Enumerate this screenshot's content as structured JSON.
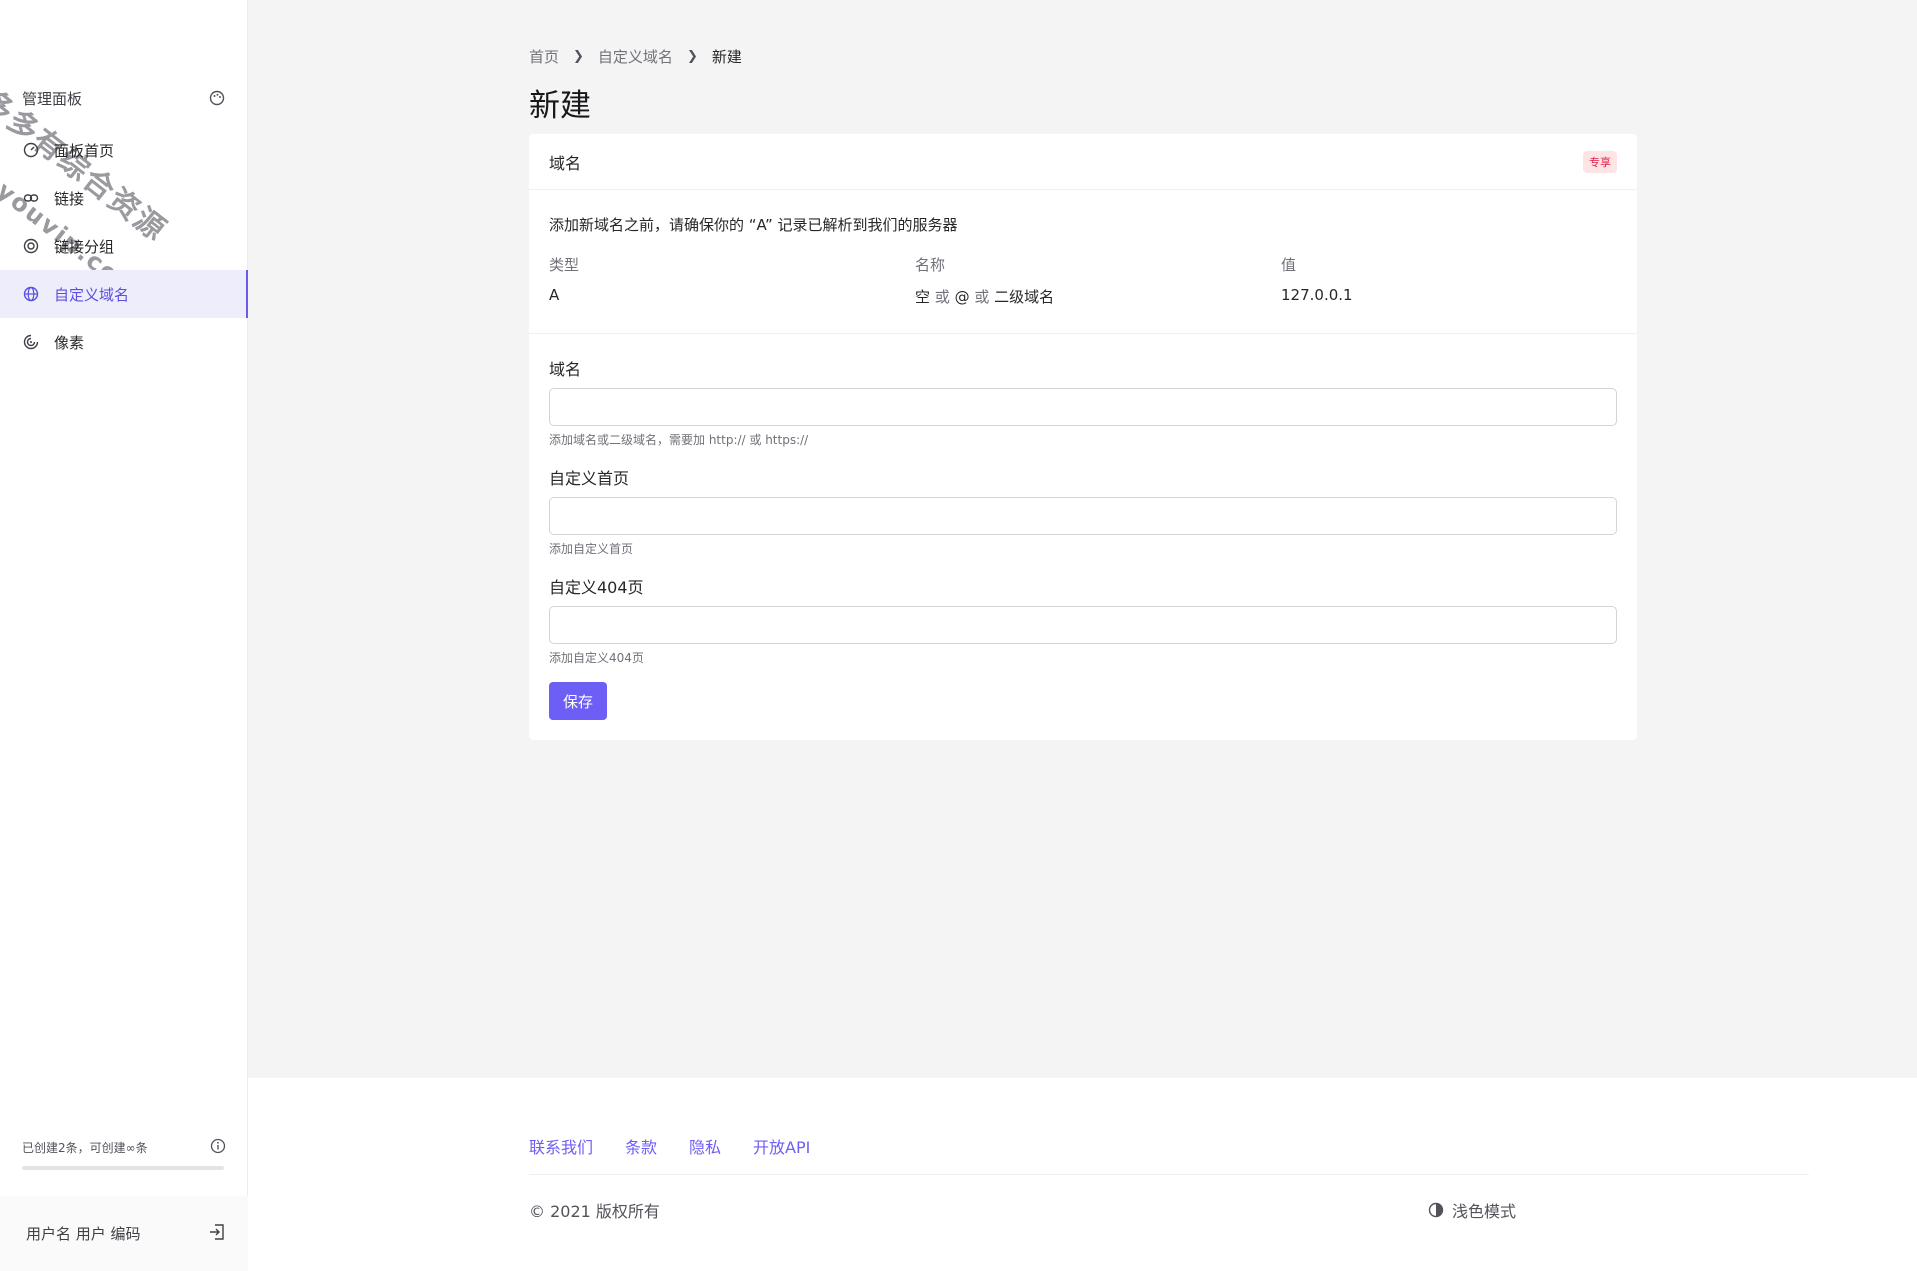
{
  "sidebar": {
    "header_label": "管理面板",
    "items": [
      {
        "label": "面板首页",
        "icon": "dashboard-icon"
      },
      {
        "label": "链接",
        "icon": "link-icon"
      },
      {
        "label": "链接分组",
        "icon": "target-icon"
      },
      {
        "label": "自定义域名",
        "icon": "globe-icon",
        "active": true
      },
      {
        "label": "像素",
        "icon": "pixel-icon"
      }
    ],
    "quota_text": "已创建2条，可创建∞条",
    "user_label": "用户名 用户 编码"
  },
  "watermark": {
    "line1": "多多有综合资源网",
    "line2": "douyouvip.com"
  },
  "breadcrumb": {
    "home": "首页",
    "parent": "自定义域名",
    "current": "新建"
  },
  "page_title": "新建",
  "card": {
    "title": "域名",
    "badge": "专享",
    "info_text": "添加新域名之前，请确保你的 “A” 记录已解析到我们的服务器",
    "columns": [
      "类型",
      "名称",
      "值"
    ],
    "row": {
      "type": "A",
      "name_parts": [
        "空",
        "或",
        "@",
        "或",
        "二级域名"
      ],
      "value": "127.0.0.1"
    }
  },
  "form": {
    "domain": {
      "label": "域名",
      "value": "",
      "placeholder": "",
      "hint": "添加域名或二级域名，需要加 http:// 或 https://"
    },
    "index": {
      "label": "自定义首页",
      "value": "",
      "placeholder": "",
      "hint": "添加自定义首页"
    },
    "notfound": {
      "label": "自定义404页",
      "value": "",
      "placeholder": "",
      "hint": "添加自定义404页"
    },
    "save_label": "保存"
  },
  "footer": {
    "links": [
      "联系我们",
      "条款",
      "隐私",
      "开放API"
    ],
    "copyright": "© 2021 版权所有",
    "theme_label": "浅色模式"
  },
  "colors": {
    "accent": "#6d5ef5",
    "active_bg": "#eeedfc",
    "badge_text": "#e11d48",
    "badge_bg": "#ffe4e6"
  }
}
